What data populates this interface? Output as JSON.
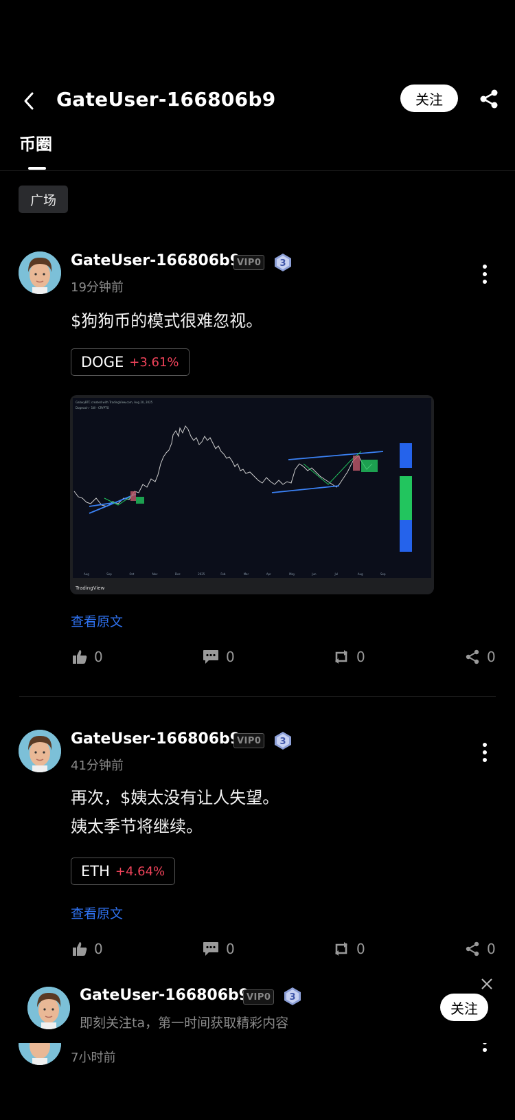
{
  "header": {
    "title": "GateUser-166806b9",
    "follow_label": "关注"
  },
  "tabs": [
    {
      "label": "币圈"
    }
  ],
  "chip": {
    "label": "广场"
  },
  "posts": [
    {
      "username": "GateUser-166806b9",
      "vip": "VIP0",
      "level": "3",
      "time": "19分钟前",
      "lines": [
        "$狗狗币的模式很难忽视。"
      ],
      "ticker": {
        "symbol": "DOGE",
        "change": "+3.61%"
      },
      "chart": {
        "watermark": "TradingView",
        "x_ticks": [
          "Aug",
          "Sep",
          "Oct",
          "Nov",
          "Dec",
          "2025",
          "Feb",
          "Mar",
          "Apr",
          "May",
          "Jun",
          "Jul",
          "Aug",
          "Sep"
        ]
      },
      "view_original": "查看原文",
      "likes": "0",
      "comments": "0",
      "reposts": "0",
      "shares": "0"
    },
    {
      "username": "GateUser-166806b9",
      "vip": "VIP0",
      "level": "3",
      "time": "41分钟前",
      "lines": [
        "再次，$姨太没有让人失望。",
        "姨太季节将继续。"
      ],
      "ticker": {
        "symbol": "ETH",
        "change": "+4.64%"
      },
      "view_original": "查看原文",
      "likes": "0",
      "comments": "0",
      "reposts": "0",
      "shares": "0"
    },
    {
      "time": "7小时前"
    }
  ],
  "popup": {
    "username": "GateUser-166806b9",
    "vip": "VIP0",
    "level": "3",
    "subtitle": "即刻关注ta，第一时间获取精彩内容",
    "follow_label": "关注"
  },
  "colors": {
    "positive": "#f0435a",
    "link": "#2f72f0",
    "chart_line": "#3b82f6"
  },
  "icons": [
    "back-arrow-icon",
    "share-icon",
    "more-icon",
    "like-icon",
    "comment-icon",
    "repost-icon",
    "close-icon",
    "level-badge-icon"
  ]
}
